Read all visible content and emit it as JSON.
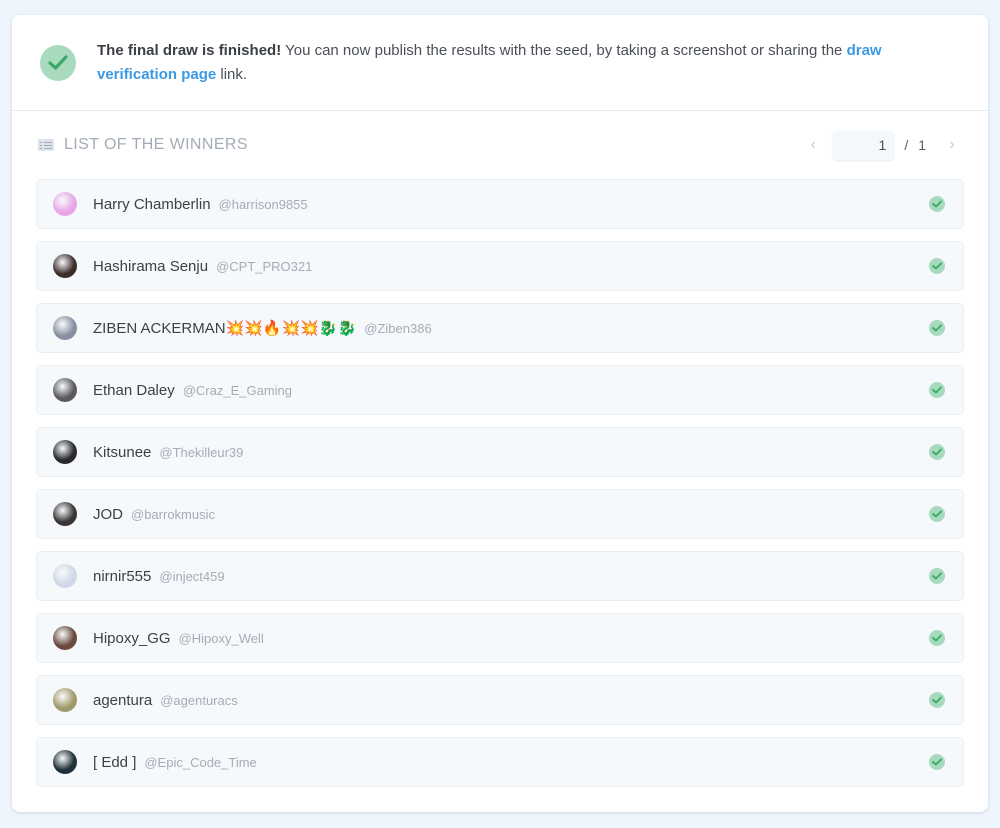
{
  "banner": {
    "bold_text": "The final draw is finished!",
    "text_before_link": " You can now publish the results with the seed, by taking a screenshot or sharing the ",
    "link_text": "draw verification page",
    "text_after_link": " link.",
    "icon": "check-circle-icon",
    "icon_color": "#a8dbbd"
  },
  "list": {
    "title": "LIST OF THE WINNERS",
    "icon": "list-icon"
  },
  "pagination": {
    "prev_icon": "‹",
    "next_icon": "›",
    "current_page": "1",
    "separator": "/",
    "total_pages": "1"
  },
  "winners": [
    {
      "name": "Harry Chamberlin",
      "handle": "@harrison9855",
      "avatar_color": "#e7a6e6",
      "verified": true
    },
    {
      "name": "Hashirama Senju",
      "handle": "@CPT_PRO321",
      "avatar_color": "#3a2e2a",
      "verified": true
    },
    {
      "name": "ZIBEN ACKERMAN💥💥🔥💥💥🐉🐉",
      "handle": "@Ziben386",
      "avatar_color": "#8890a0",
      "verified": true
    },
    {
      "name": "Ethan Daley",
      "handle": "@Craz_E_Gaming",
      "avatar_color": "#5a5a5e",
      "verified": true
    },
    {
      "name": "Kitsunee",
      "handle": "@Thekilleur39",
      "avatar_color": "#2a2a2c",
      "verified": true
    },
    {
      "name": "JOD",
      "handle": "@barrokmusic",
      "avatar_color": "#3a3636",
      "verified": true
    },
    {
      "name": "nirnir555",
      "handle": "@inject459",
      "avatar_color": "#cfd8e6",
      "verified": true
    },
    {
      "name": "Hipoxy_GG",
      "handle": "@Hipoxy_Well",
      "avatar_color": "#6a4a3e",
      "verified": true
    },
    {
      "name": "agentura",
      "handle": "@agenturacs",
      "avatar_color": "#a09a6a",
      "verified": true
    },
    {
      "name": "[ Edd ]",
      "handle": "@Epic_Code_Time",
      "avatar_color": "#1e3038",
      "verified": true
    }
  ]
}
